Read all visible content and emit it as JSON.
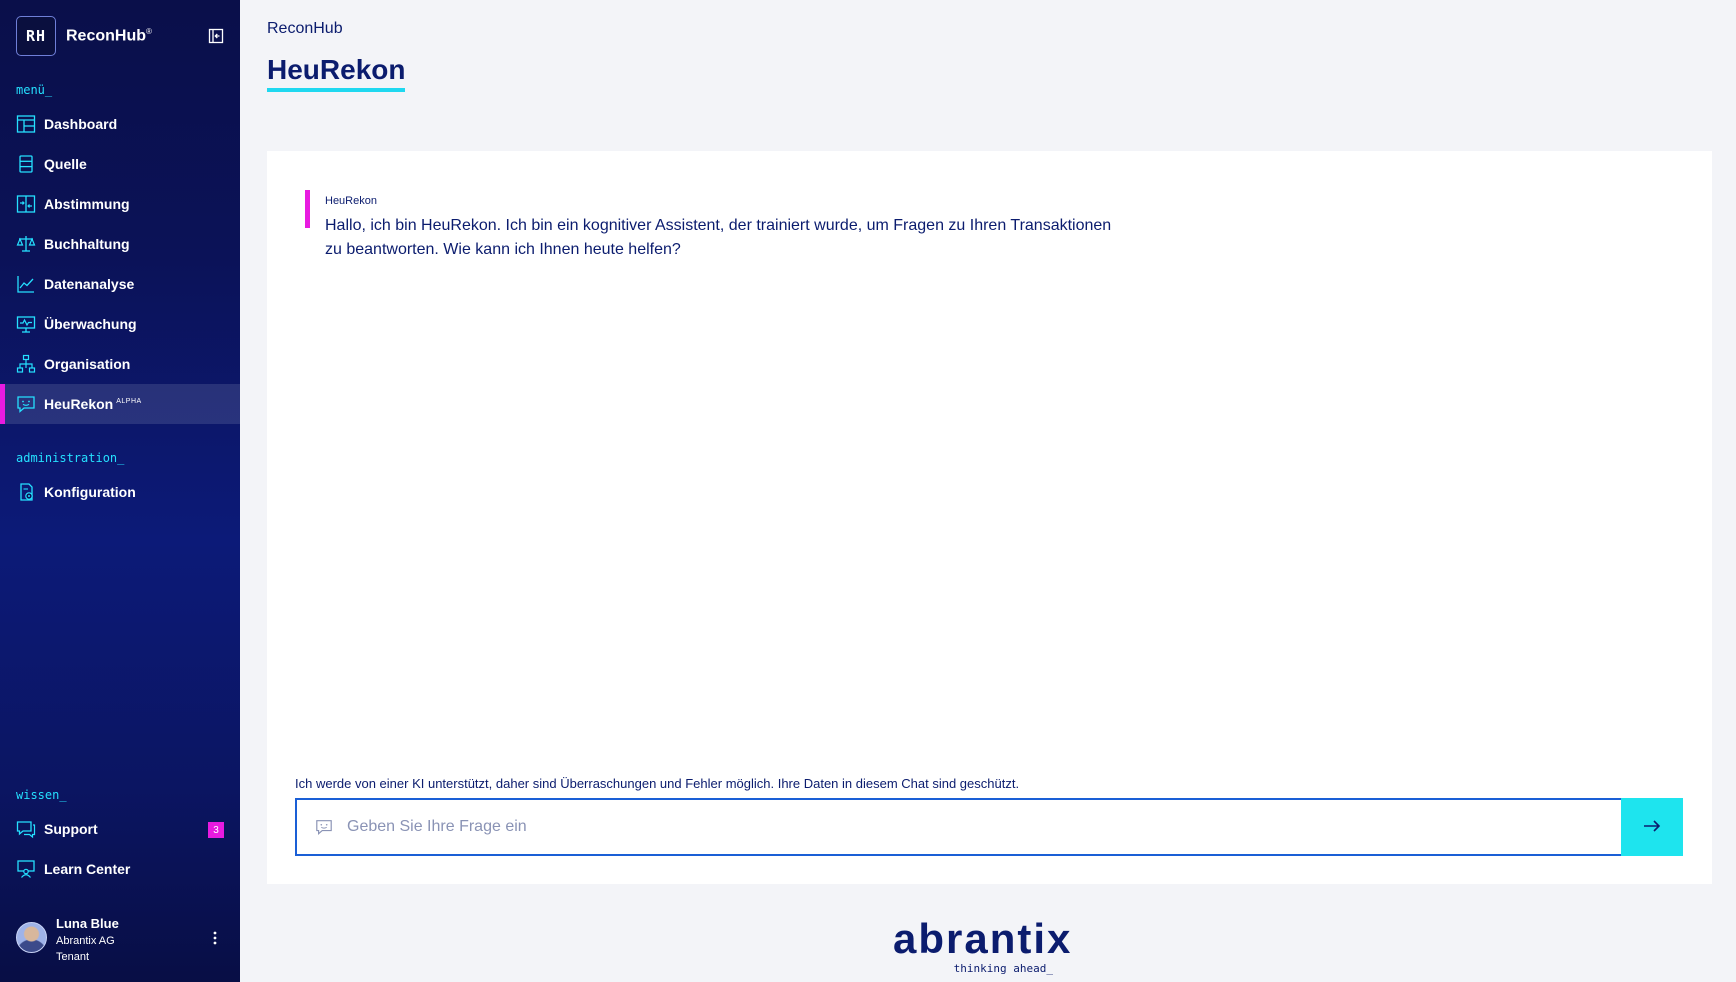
{
  "sidebar": {
    "brand": {
      "logo_text": "RH",
      "name": "ReconHub",
      "mark": "®"
    },
    "sections": {
      "menu": "menü_",
      "administration": "administration_",
      "wissen": "wissen_"
    },
    "menu_items": [
      {
        "label": "Dashboard",
        "icon": "dashboard-icon"
      },
      {
        "label": "Quelle",
        "icon": "database-icon"
      },
      {
        "label": "Abstimmung",
        "icon": "reconcile-icon"
      },
      {
        "label": "Buchhaltung",
        "icon": "scale-icon"
      },
      {
        "label": "Datenanalyse",
        "icon": "chart-line-icon"
      },
      {
        "label": "Überwachung",
        "icon": "monitor-icon"
      },
      {
        "label": "Organisation",
        "icon": "org-chart-icon"
      },
      {
        "label": "HeuRekon",
        "sup": "ALPHA",
        "icon": "chat-bot-icon",
        "active": true
      }
    ],
    "admin_items": [
      {
        "label": "Konfiguration",
        "icon": "config-icon"
      }
    ],
    "wissen_items": [
      {
        "label": "Support",
        "icon": "support-chat-icon",
        "badge": "3"
      },
      {
        "label": "Learn Center",
        "icon": "learn-icon"
      }
    ],
    "user": {
      "name": "Luna Blue",
      "company": "Abrantix AG",
      "role": "Tenant"
    }
  },
  "header": {
    "breadcrumb": "ReconHub",
    "title": "HeuRekon"
  },
  "chat": {
    "messages": [
      {
        "sender": "HeuRekon",
        "text": "Hallo, ich bin HeuRekon. Ich bin ein kognitiver Assistent, der trainiert wurde, um Fragen zu Ihren Transaktionen zu beantworten. Wie kann ich Ihnen heute helfen?"
      }
    ],
    "disclaimer": "Ich werde von einer KI unterstützt, daher sind Überraschungen und Fehler möglich. Ihre Daten in diesem Chat sind geschützt.",
    "input_placeholder": "Geben Sie Ihre Frage ein",
    "input_value": ""
  },
  "footer": {
    "wordmark": "abrantix",
    "tagline": "thinking ahead_"
  },
  "colors": {
    "accent": "#1fd8f0",
    "magenta": "#e81be0",
    "navy": "#0b1c6e",
    "input_border": "#1a5fd6"
  }
}
